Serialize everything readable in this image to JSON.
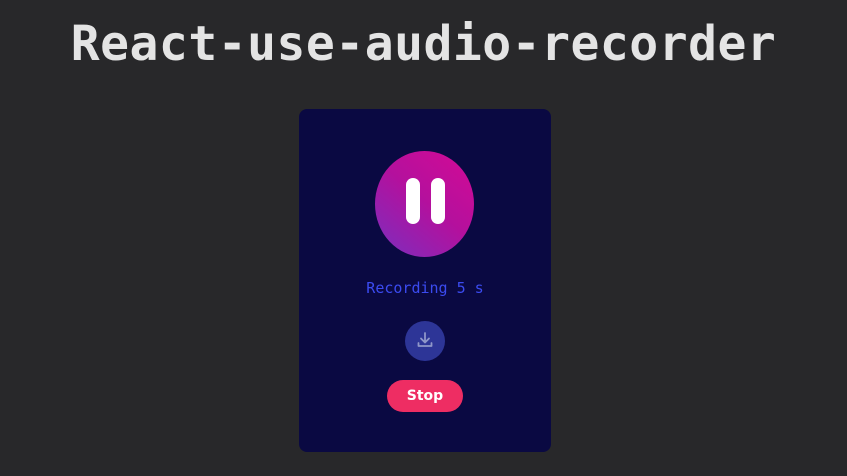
{
  "page": {
    "title": "React-use-audio-recorder"
  },
  "recorder": {
    "status_text": "Recording 5 s",
    "stop_label": "Stop",
    "icons": {
      "toggle": "pause-icon",
      "download": "download-icon"
    }
  },
  "colors": {
    "background": "#28282a",
    "card": "#0a0942",
    "toggle_gradient_start": "#d40a95",
    "toggle_gradient_end": "#7a2fbf",
    "status_text": "#3b4bf0",
    "download_button": "#2d3597",
    "stop_button": "#ee2d63",
    "title": "#e4e4e4"
  }
}
